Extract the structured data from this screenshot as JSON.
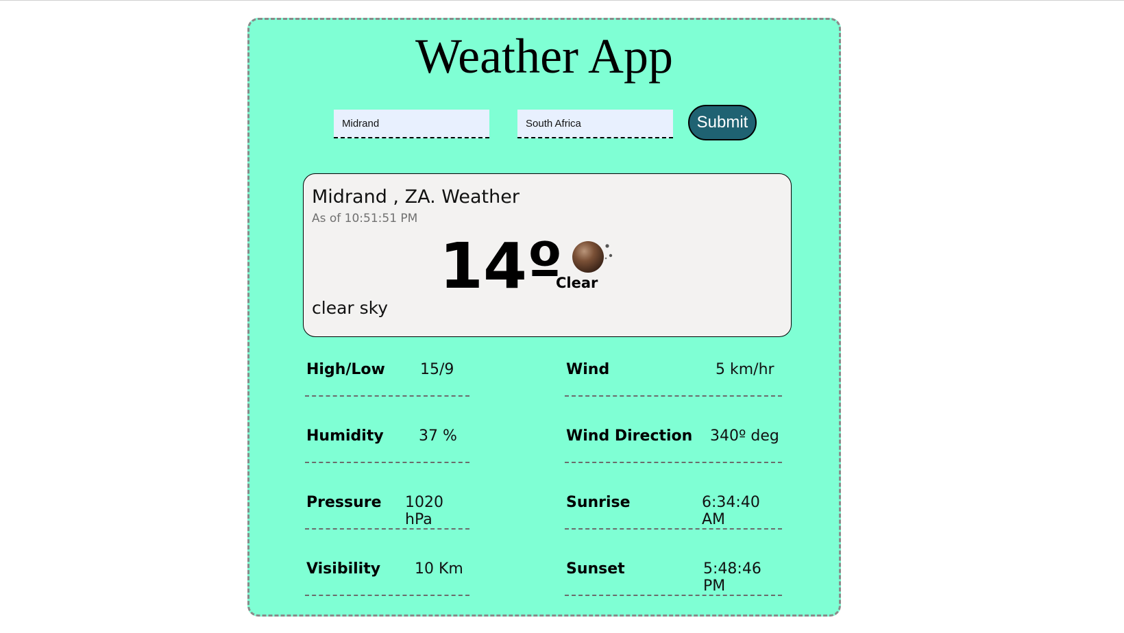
{
  "app": {
    "title": "Weather App"
  },
  "form": {
    "city_value": "Midrand",
    "country_value": "South Africa",
    "submit_label": "Submit"
  },
  "current": {
    "location_title": "Midrand , ZA. Weather",
    "as_of": "As of 10:51:51 PM",
    "temperature": "14º",
    "condition": "Clear",
    "description": "clear sky",
    "icon": "clear-night-moon-icon"
  },
  "stats": {
    "high_low": {
      "label": "High/Low",
      "value": "15/9"
    },
    "humidity": {
      "label": "Humidity",
      "value": "37 %"
    },
    "pressure": {
      "label": "Pressure",
      "value": "1020 hPa"
    },
    "visibility": {
      "label": "Visibility",
      "value": "10 Km"
    },
    "wind": {
      "label": "Wind",
      "value": "5 km/hr"
    },
    "wind_direction": {
      "label": "Wind Direction",
      "value": "340º deg"
    },
    "sunrise": {
      "label": "Sunrise",
      "value": "6:34:40 AM"
    },
    "sunset": {
      "label": "Sunset",
      "value": "5:48:46 PM"
    }
  },
  "colors": {
    "app_background": "#7fffd4",
    "card_background": "#f3f2f1",
    "input_background": "#e8f0fe",
    "submit_background": "#1f6272"
  }
}
